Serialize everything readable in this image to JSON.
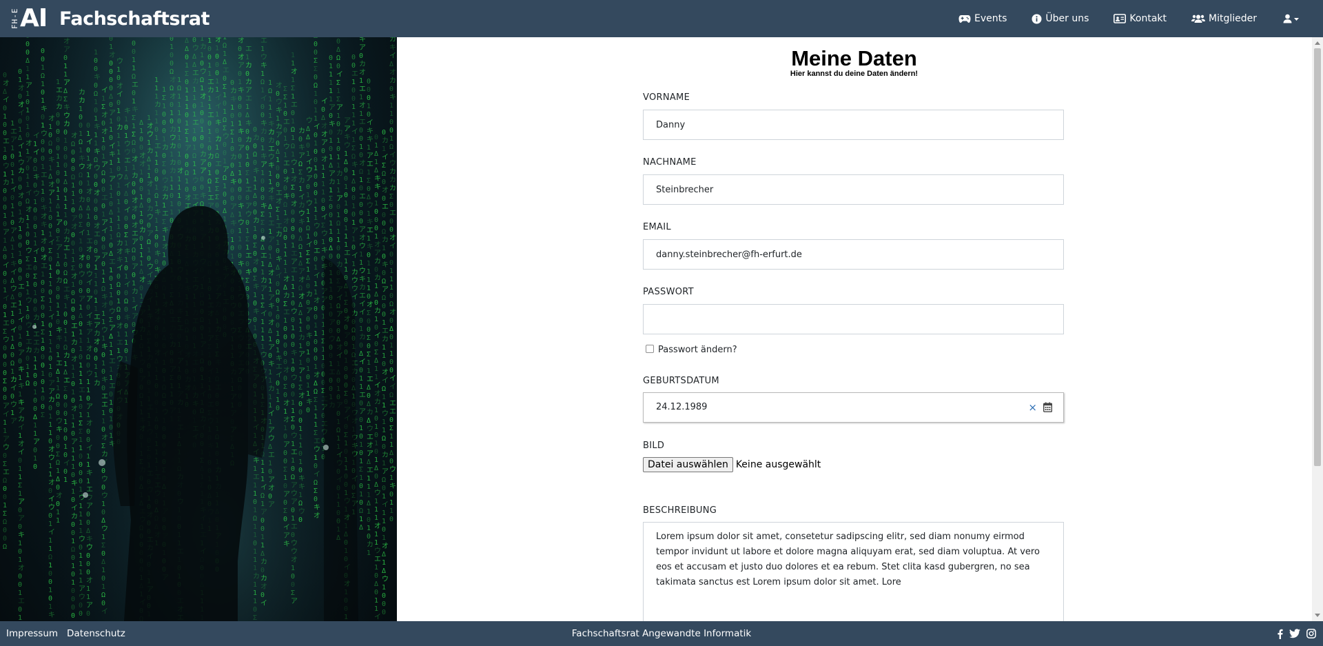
{
  "header": {
    "logo_letters": "AI",
    "logo_small": "FH-E",
    "title": "Fachschaftsrat",
    "nav": [
      {
        "label": "Events",
        "icon": "gamepad-icon"
      },
      {
        "label": "Über uns",
        "icon": "info-circle-icon"
      },
      {
        "label": "Kontakt",
        "icon": "id-card-icon"
      },
      {
        "label": "Mitglieder",
        "icon": "users-icon"
      }
    ],
    "user_menu_icon": "user-dropdown-icon"
  },
  "page": {
    "title": "Meine Daten",
    "subtitle": "Hier kannst du deine Daten ändern!"
  },
  "form": {
    "vorname": {
      "label": "VORNAME",
      "value": "Danny"
    },
    "nachname": {
      "label": "NACHNAME",
      "value": "Steinbrecher"
    },
    "email": {
      "label": "EMAIL",
      "value": "danny.steinbrecher@fh-erfurt.de"
    },
    "passwort": {
      "label": "PASSWORT",
      "value": ""
    },
    "passwort_aendern": {
      "label": "Passwort ändern?",
      "checked": false
    },
    "geburtsdatum": {
      "label": "GEBURTSDATUM",
      "value": "24.12.1989",
      "clear_symbol": "×"
    },
    "bild": {
      "label": "BILD",
      "button": "Datei auswählen",
      "status": "Keine ausgewählt"
    },
    "beschreibung": {
      "label": "BESCHREIBUNG",
      "value": "Lorem ipsum dolor sit amet, consetetur sadipscing elitr, sed diam nonumy eirmod tempor invidunt ut labore et dolore magna aliquyam erat, sed diam voluptua. At vero eos et accusam et justo duo dolores et ea rebum. Stet clita kasd gubergren, no sea takimata sanctus est Lorem ipsum dolor sit amet. Lore"
    }
  },
  "footer": {
    "links": [
      "Impressum",
      "Datenschutz"
    ],
    "center": "Fachschaftsrat Angewandte Informatik",
    "social": [
      "facebook-icon",
      "twitter-icon",
      "instagram-icon"
    ]
  },
  "colors": {
    "navbar": "#34495e",
    "matrix_green": "#2fd34a"
  }
}
